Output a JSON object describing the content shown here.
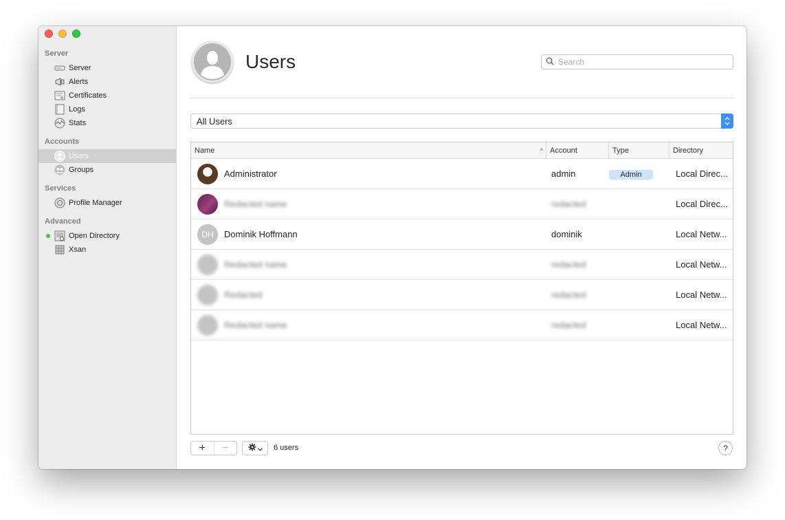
{
  "window": {
    "traffic_lights": [
      "close",
      "minimize",
      "zoom"
    ]
  },
  "sidebar": {
    "sections": [
      {
        "header": "Server",
        "items": [
          {
            "label": "Server",
            "icon": "server-icon"
          },
          {
            "label": "Alerts",
            "icon": "megaphone-icon"
          },
          {
            "label": "Certificates",
            "icon": "certificate-icon"
          },
          {
            "label": "Logs",
            "icon": "logs-icon"
          },
          {
            "label": "Stats",
            "icon": "stats-icon"
          }
        ]
      },
      {
        "header": "Accounts",
        "items": [
          {
            "label": "Users",
            "icon": "user-icon",
            "selected": true
          },
          {
            "label": "Groups",
            "icon": "groups-icon"
          }
        ]
      },
      {
        "header": "Services",
        "items": [
          {
            "label": "Profile Manager",
            "icon": "profile-manager-icon"
          }
        ]
      },
      {
        "header": "Advanced",
        "items": [
          {
            "label": "Open Directory",
            "icon": "open-directory-icon",
            "status": "running"
          },
          {
            "label": "Xsan",
            "icon": "xsan-icon"
          }
        ]
      }
    ]
  },
  "main": {
    "title": "Users",
    "search": {
      "placeholder": "Search",
      "value": ""
    },
    "filter": {
      "selected": "All Users"
    },
    "table": {
      "columns": [
        "Name",
        "Account",
        "Type",
        "Directory"
      ],
      "sorted_column": "Name",
      "rows": [
        {
          "avatar": "eagle",
          "initials": "",
          "name": "Administrator",
          "account": "admin",
          "type": "Admin",
          "directory": "Local Direc...",
          "redacted": false
        },
        {
          "avatar": "purple",
          "initials": "",
          "name": "Redacted name",
          "account": "redacted",
          "type": "",
          "directory": "Local Direc...",
          "redacted": true
        },
        {
          "avatar": "initials",
          "initials": "DH",
          "name": "Dominik Hoffmann",
          "account": "dominik",
          "type": "",
          "directory": "Local Netw...",
          "redacted": false
        },
        {
          "avatar": "initials",
          "initials": "",
          "name": "Redacted name",
          "account": "redacted",
          "type": "",
          "directory": "Local Netw...",
          "redacted": true
        },
        {
          "avatar": "initials",
          "initials": "",
          "name": "Redacted",
          "account": "redacted",
          "type": "",
          "directory": "Local Netw...",
          "redacted": true
        },
        {
          "avatar": "initials",
          "initials": "",
          "name": "Redacted name",
          "account": "redacted",
          "type": "",
          "directory": "Local Netw...",
          "redacted": true
        }
      ]
    },
    "footer": {
      "add_label": "+",
      "remove_label": "−",
      "user_count": "6 users",
      "help_label": "?"
    }
  },
  "colors": {
    "accent": "#3b8ff6",
    "admin_badge": "#cfe4fb",
    "status_green": "#3fc44a",
    "sidebar_bg": "#ececec",
    "sidebar_selected": "#d0d0d0"
  }
}
